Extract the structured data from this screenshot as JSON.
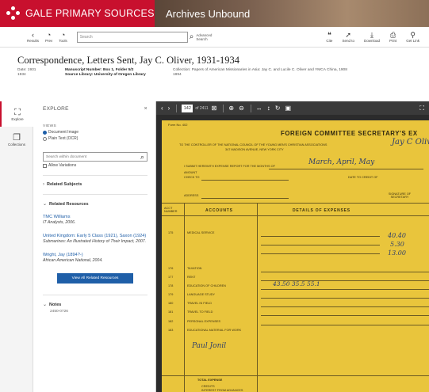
{
  "header": {
    "brand": "GALE PRIMARY SOURCES",
    "product": "Archives Unbound",
    "brand_color": "#c8102e"
  },
  "toolbar": {
    "left_buttons": [
      {
        "icon": "chevron-left-icon",
        "label": "Results"
      },
      {
        "icon": "history-icon",
        "label": "Prev"
      },
      {
        "icon": "history-icon",
        "label": "Tools"
      }
    ],
    "search_placeholder": "Search",
    "advanced_label": "Advanced Search",
    "right_buttons": [
      {
        "icon": "cite-icon",
        "label": "Cite"
      },
      {
        "icon": "send-icon",
        "label": "Send to"
      },
      {
        "icon": "download-icon",
        "label": "Download"
      },
      {
        "icon": "print-icon",
        "label": "Print"
      },
      {
        "icon": "get-link-icon",
        "label": "Get Link"
      }
    ]
  },
  "document": {
    "title": "Correspondence, Letters Sent, Jay C. Oliver, 1931-1934",
    "date_label": "Date: 1931",
    "date_sub": "1934",
    "manuscript_label": "Manuscript Number: Box 1, Folder 5/2",
    "source_library": "Source Library: University of Oregon Library",
    "collection_label": "Collection: Papers of American Missionaries in Asia: Jay C. and Lucile C. Oliver and YMCA China, 1908",
    "collection_sub": "1994"
  },
  "rail": {
    "items": [
      {
        "icon": "explore-icon",
        "label": "Explore",
        "active": true
      },
      {
        "icon": "collections-icon",
        "label": "Collections",
        "active": false
      }
    ]
  },
  "panel": {
    "title": "EXPLORE",
    "views_label": "VIEWS",
    "view_options": [
      "Document Image",
      "Plain Text (OCR)"
    ],
    "search_placeholder": "Search within document",
    "allow_variations": "Allow Variations",
    "related_subjects": "Related Subjects",
    "related_resources": "Related Resources",
    "resources": [
      {
        "title": "TMC Williams",
        "source": "IT Analysts, 2006."
      },
      {
        "title": "United Kingdom: Early 5 Class (1921), Saxon (1924)",
        "source": "Submarines: An Illustrated History of Their Impact, 2007."
      },
      {
        "title": "Wright, Jay (1894?-)",
        "source": "African American National, 2004."
      }
    ],
    "view_all_button": "View All Related Resources",
    "notes_label": "Notes",
    "notes_value": "2450-0726"
  },
  "viewer": {
    "page_current": "142",
    "page_of": "of 2411",
    "paper_color": "#e9c53c"
  },
  "paper": {
    "top_left": "Form No. 402",
    "heading": "FOREIGN COMMITTEE SECRETARY'S EX",
    "to_line": "TO THE CONTROLLER OF THE NATIONAL COUNCIL OF THE YOUNG MEN'S CHRISTIAN ASSOCIATIONS",
    "to_line2": "347 MADISON AVENUE, NEW YORK CITY",
    "submit_line": "I SUBMIT HEREWITH EXPENSE REPORT FOR THE MONTHS OF",
    "hw_months": "March, April, May",
    "hw_sig_top": "Jay C Oliver",
    "amount_line": "AMOUNT",
    "check_line": "CHECK TO",
    "date_to": "DATE TO CREDIT OF",
    "address_line": "ADDRESS",
    "sig_line": "SIGNATURE OF SECRETARY",
    "col_acct": "ACCT NUMBER",
    "col_accounts": "ACCOUNTS",
    "col_details": "DETAILS OF EXPENSES",
    "rows": [
      {
        "num": "175",
        "label": "MEDICAL SERVICE"
      },
      {
        "num": "176",
        "label": "TAXATION"
      },
      {
        "num": "177",
        "label": "RENT"
      },
      {
        "num": "178",
        "label": "EDUCATION OF CHILDREN"
      },
      {
        "num": "179",
        "label": "LANGUAGE STUDY"
      },
      {
        "num": "180",
        "label": "TRAVEL IN FIELD"
      },
      {
        "num": "181",
        "label": "TRAVEL TO FIELD"
      },
      {
        "num": "182",
        "label": "PERSONAL EXPENSES"
      },
      {
        "num": "183",
        "label": "EDUCATIONAL MATERIAL FOR WORK"
      }
    ],
    "hw_amounts": [
      "40.40",
      "5.30",
      "13.00"
    ],
    "hw_row2": "43.50   35.5   55.1",
    "hw_sign": "Paul Jonil",
    "total_label": "TOTAL EXPENSE",
    "credits_label": "CREDITS",
    "credits_sub": "INTEREST FROM ADVANCES"
  }
}
